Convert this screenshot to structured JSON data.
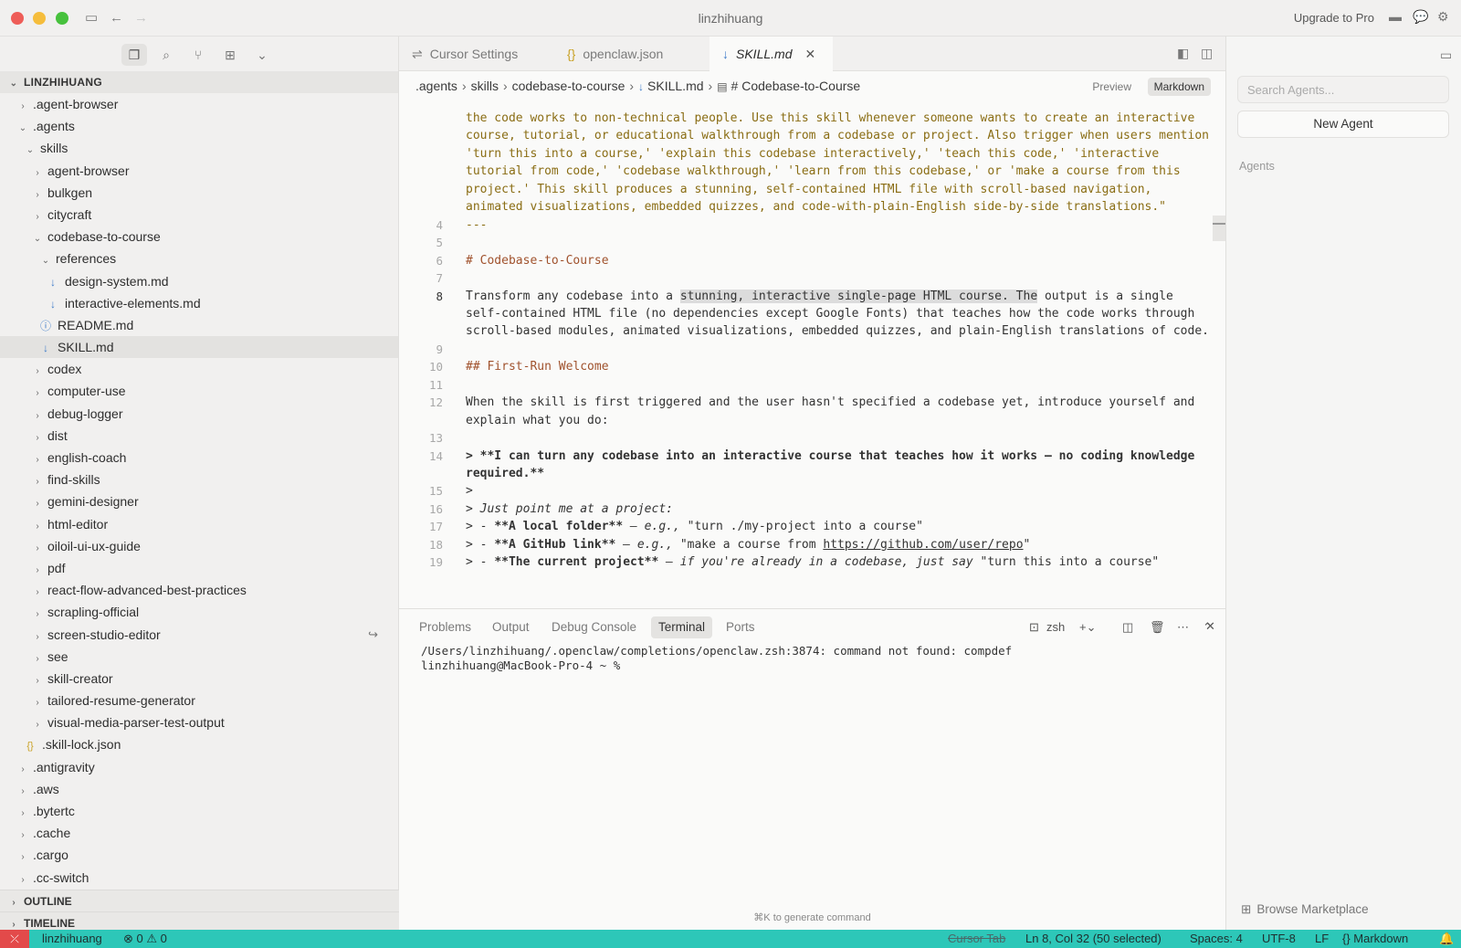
{
  "window": {
    "title": "linzhihuang",
    "upgrade": "Upgrade to Pro"
  },
  "sidebar": {
    "root": "LINZHIHUANG",
    "tree": [
      {
        "label": ".agent-browser",
        "depth": 1,
        "chev": "›",
        "icon": ""
      },
      {
        "label": ".agents",
        "depth": 1,
        "chev": "⌄",
        "icon": ""
      },
      {
        "label": "skills",
        "depth": 2,
        "chev": "⌄",
        "icon": ""
      },
      {
        "label": "agent-browser",
        "depth": 3,
        "chev": "›",
        "icon": ""
      },
      {
        "label": "bulkgen",
        "depth": 3,
        "chev": "›",
        "icon": ""
      },
      {
        "label": "citycraft",
        "depth": 3,
        "chev": "›",
        "icon": ""
      },
      {
        "label": "codebase-to-course",
        "depth": 3,
        "chev": "⌄",
        "icon": ""
      },
      {
        "label": "references",
        "depth": 4,
        "chev": "⌄",
        "icon": ""
      },
      {
        "label": "design-system.md",
        "depth": 5,
        "chev": "",
        "icon": "md"
      },
      {
        "label": "interactive-elements.md",
        "depth": 5,
        "chev": "",
        "icon": "md"
      },
      {
        "label": "README.md",
        "depth": 4,
        "chev": "",
        "icon": "info"
      },
      {
        "label": "SKILL.md",
        "depth": 4,
        "chev": "",
        "icon": "md",
        "selected": true
      },
      {
        "label": "codex",
        "depth": 3,
        "chev": "›",
        "icon": ""
      },
      {
        "label": "computer-use",
        "depth": 3,
        "chev": "›",
        "icon": ""
      },
      {
        "label": "debug-logger",
        "depth": 3,
        "chev": "›",
        "icon": ""
      },
      {
        "label": "dist",
        "depth": 3,
        "chev": "›",
        "icon": ""
      },
      {
        "label": "english-coach",
        "depth": 3,
        "chev": "›",
        "icon": ""
      },
      {
        "label": "find-skills",
        "depth": 3,
        "chev": "›",
        "icon": ""
      },
      {
        "label": "gemini-designer",
        "depth": 3,
        "chev": "›",
        "icon": ""
      },
      {
        "label": "html-editor",
        "depth": 3,
        "chev": "›",
        "icon": ""
      },
      {
        "label": "oiloil-ui-ux-guide",
        "depth": 3,
        "chev": "›",
        "icon": ""
      },
      {
        "label": "pdf",
        "depth": 3,
        "chev": "›",
        "icon": ""
      },
      {
        "label": "react-flow-advanced-best-practices",
        "depth": 3,
        "chev": "›",
        "icon": ""
      },
      {
        "label": "scrapling-official",
        "depth": 3,
        "chev": "›",
        "icon": ""
      },
      {
        "label": "screen-studio-editor",
        "depth": 3,
        "chev": "›",
        "icon": "",
        "extra": "↪"
      },
      {
        "label": "see",
        "depth": 3,
        "chev": "›",
        "icon": ""
      },
      {
        "label": "skill-creator",
        "depth": 3,
        "chev": "›",
        "icon": ""
      },
      {
        "label": "tailored-resume-generator",
        "depth": 3,
        "chev": "›",
        "icon": ""
      },
      {
        "label": "visual-media-parser-test-output",
        "depth": 3,
        "chev": "›",
        "icon": ""
      },
      {
        "label": ".skill-lock.json",
        "depth": 2,
        "chev": "",
        "icon": "json"
      },
      {
        "label": ".antigravity",
        "depth": 1,
        "chev": "›",
        "icon": ""
      },
      {
        "label": ".aws",
        "depth": 1,
        "chev": "›",
        "icon": ""
      },
      {
        "label": ".bytertc",
        "depth": 1,
        "chev": "›",
        "icon": ""
      },
      {
        "label": ".cache",
        "depth": 1,
        "chev": "›",
        "icon": ""
      },
      {
        "label": ".cargo",
        "depth": 1,
        "chev": "›",
        "icon": ""
      },
      {
        "label": ".cc-switch",
        "depth": 1,
        "chev": "›",
        "icon": ""
      }
    ],
    "outline": "OUTLINE",
    "timeline": "TIMELINE"
  },
  "editor": {
    "tabs": [
      {
        "label": "Cursor Settings",
        "icon": "⇌"
      },
      {
        "label": "openclaw.json",
        "icon": "{}"
      },
      {
        "label": "SKILL.md",
        "icon": "↓",
        "active": true
      }
    ],
    "breadcrumb": [
      ".agents",
      "skills",
      "codebase-to-course",
      "SKILL.md",
      "# Codebase-to-Course"
    ],
    "preview": "Preview",
    "markdown": "Markdown",
    "lines": [
      {
        "n": "",
        "text": "the code works to non-technical people. Use this skill whenever someone wants to create an interactive",
        "cls": "fm"
      },
      {
        "n": "",
        "text": "course, tutorial, or educational walkthrough from a codebase or project. Also trigger when users mention",
        "cls": "fm"
      },
      {
        "n": "",
        "text": "'turn this into a course,' 'explain this codebase interactively,' 'teach this code,' 'interactive",
        "cls": "fm"
      },
      {
        "n": "",
        "text": "tutorial from code,' 'codebase walkthrough,' 'learn from this codebase,' or 'make a course from this",
        "cls": "fm"
      },
      {
        "n": "",
        "text": "project.' This skill produces a stunning, self-contained HTML file with scroll-based navigation,",
        "cls": "fm"
      },
      {
        "n": "",
        "text": "animated visualizations, embedded quizzes, and code-with-plain-English side-by-side translations.\"",
        "cls": "fm"
      },
      {
        "n": "4",
        "text": "---",
        "cls": "fm"
      },
      {
        "n": "5",
        "text": "",
        "cls": ""
      },
      {
        "n": "6",
        "text": "# Codebase-to-Course",
        "cls": "h"
      },
      {
        "n": "7",
        "text": "",
        "cls": ""
      },
      {
        "n": "8",
        "text": "",
        "cls": "",
        "special": "line8"
      },
      {
        "n": "",
        "text": "self-contained HTML file (no dependencies except Google Fonts) that teaches how the code works through",
        "cls": ""
      },
      {
        "n": "",
        "text": "scroll-based modules, animated visualizations, embedded quizzes, and plain-English translations of code.",
        "cls": ""
      },
      {
        "n": "9",
        "text": "",
        "cls": ""
      },
      {
        "n": "10",
        "text": "## First-Run Welcome",
        "cls": "h"
      },
      {
        "n": "11",
        "text": "",
        "cls": ""
      },
      {
        "n": "12",
        "text": "When the skill is first triggered and the user hasn't specified a codebase yet, introduce yourself and",
        "cls": ""
      },
      {
        "n": "",
        "text": "explain what you do:",
        "cls": ""
      },
      {
        "n": "13",
        "text": "",
        "cls": ""
      },
      {
        "n": "14",
        "text": "> **I can turn any codebase into an interactive course that teaches how it works — no coding knowledge",
        "cls": "b"
      },
      {
        "n": "",
        "text": "required.**",
        "cls": "b"
      },
      {
        "n": "15",
        "text": ">",
        "cls": ""
      },
      {
        "n": "16",
        "text": "",
        "cls": "",
        "special": "line16"
      },
      {
        "n": "17",
        "text": "",
        "cls": "",
        "special": "line17"
      },
      {
        "n": "18",
        "text": "",
        "cls": "",
        "special": "line18"
      },
      {
        "n": "19",
        "text": "",
        "cls": "",
        "special": "line19"
      }
    ],
    "line8": {
      "pre": "Transform any codebase into a ",
      "sel": "stunning, interactive single-page HTML course. The",
      "post": " output is a single"
    },
    "line16": {
      "pre": "> ",
      "it": "Just point me at a project:"
    },
    "line17": {
      "pre": "> - ",
      "b": "**A local folder**",
      "it": " — e.g., ",
      "post": "\"turn ./my-project into a course\""
    },
    "line18": {
      "pre": "> - ",
      "b": "**A GitHub link**",
      "it": " — e.g., ",
      "post": "\"make a course from ",
      "link": "https://github.com/user/repo",
      "end": "\""
    },
    "line19": {
      "pre": "> - ",
      "b": "**The current project**",
      "it": " — if you're already in a codebase, just say ",
      "post": "\"turn this into a course\""
    }
  },
  "panel": {
    "tabs": [
      "Problems",
      "Output",
      "Debug Console",
      "Terminal",
      "Ports"
    ],
    "active_tab": "Terminal",
    "shell": "zsh",
    "terminal": [
      "/Users/linzhihuang/.openclaw/completions/openclaw.zsh:3874: command not found: compdef",
      "linzhihuang@MacBook-Pro-4 ~ %"
    ],
    "gen_hint": "⌘K to generate command"
  },
  "agents": {
    "search_placeholder": "Search Agents...",
    "new_agent": "New Agent",
    "label": "Agents",
    "browse": "Browse Marketplace"
  },
  "status": {
    "branch": "linzhihuang",
    "errors": "0",
    "warnings": "0",
    "cursor_tab": "Cursor Tab",
    "position": "Ln 8, Col 32 (50 selected)",
    "spaces": "Spaces: 4",
    "encoding": "UTF-8",
    "eol": "LF",
    "language": "Markdown"
  }
}
